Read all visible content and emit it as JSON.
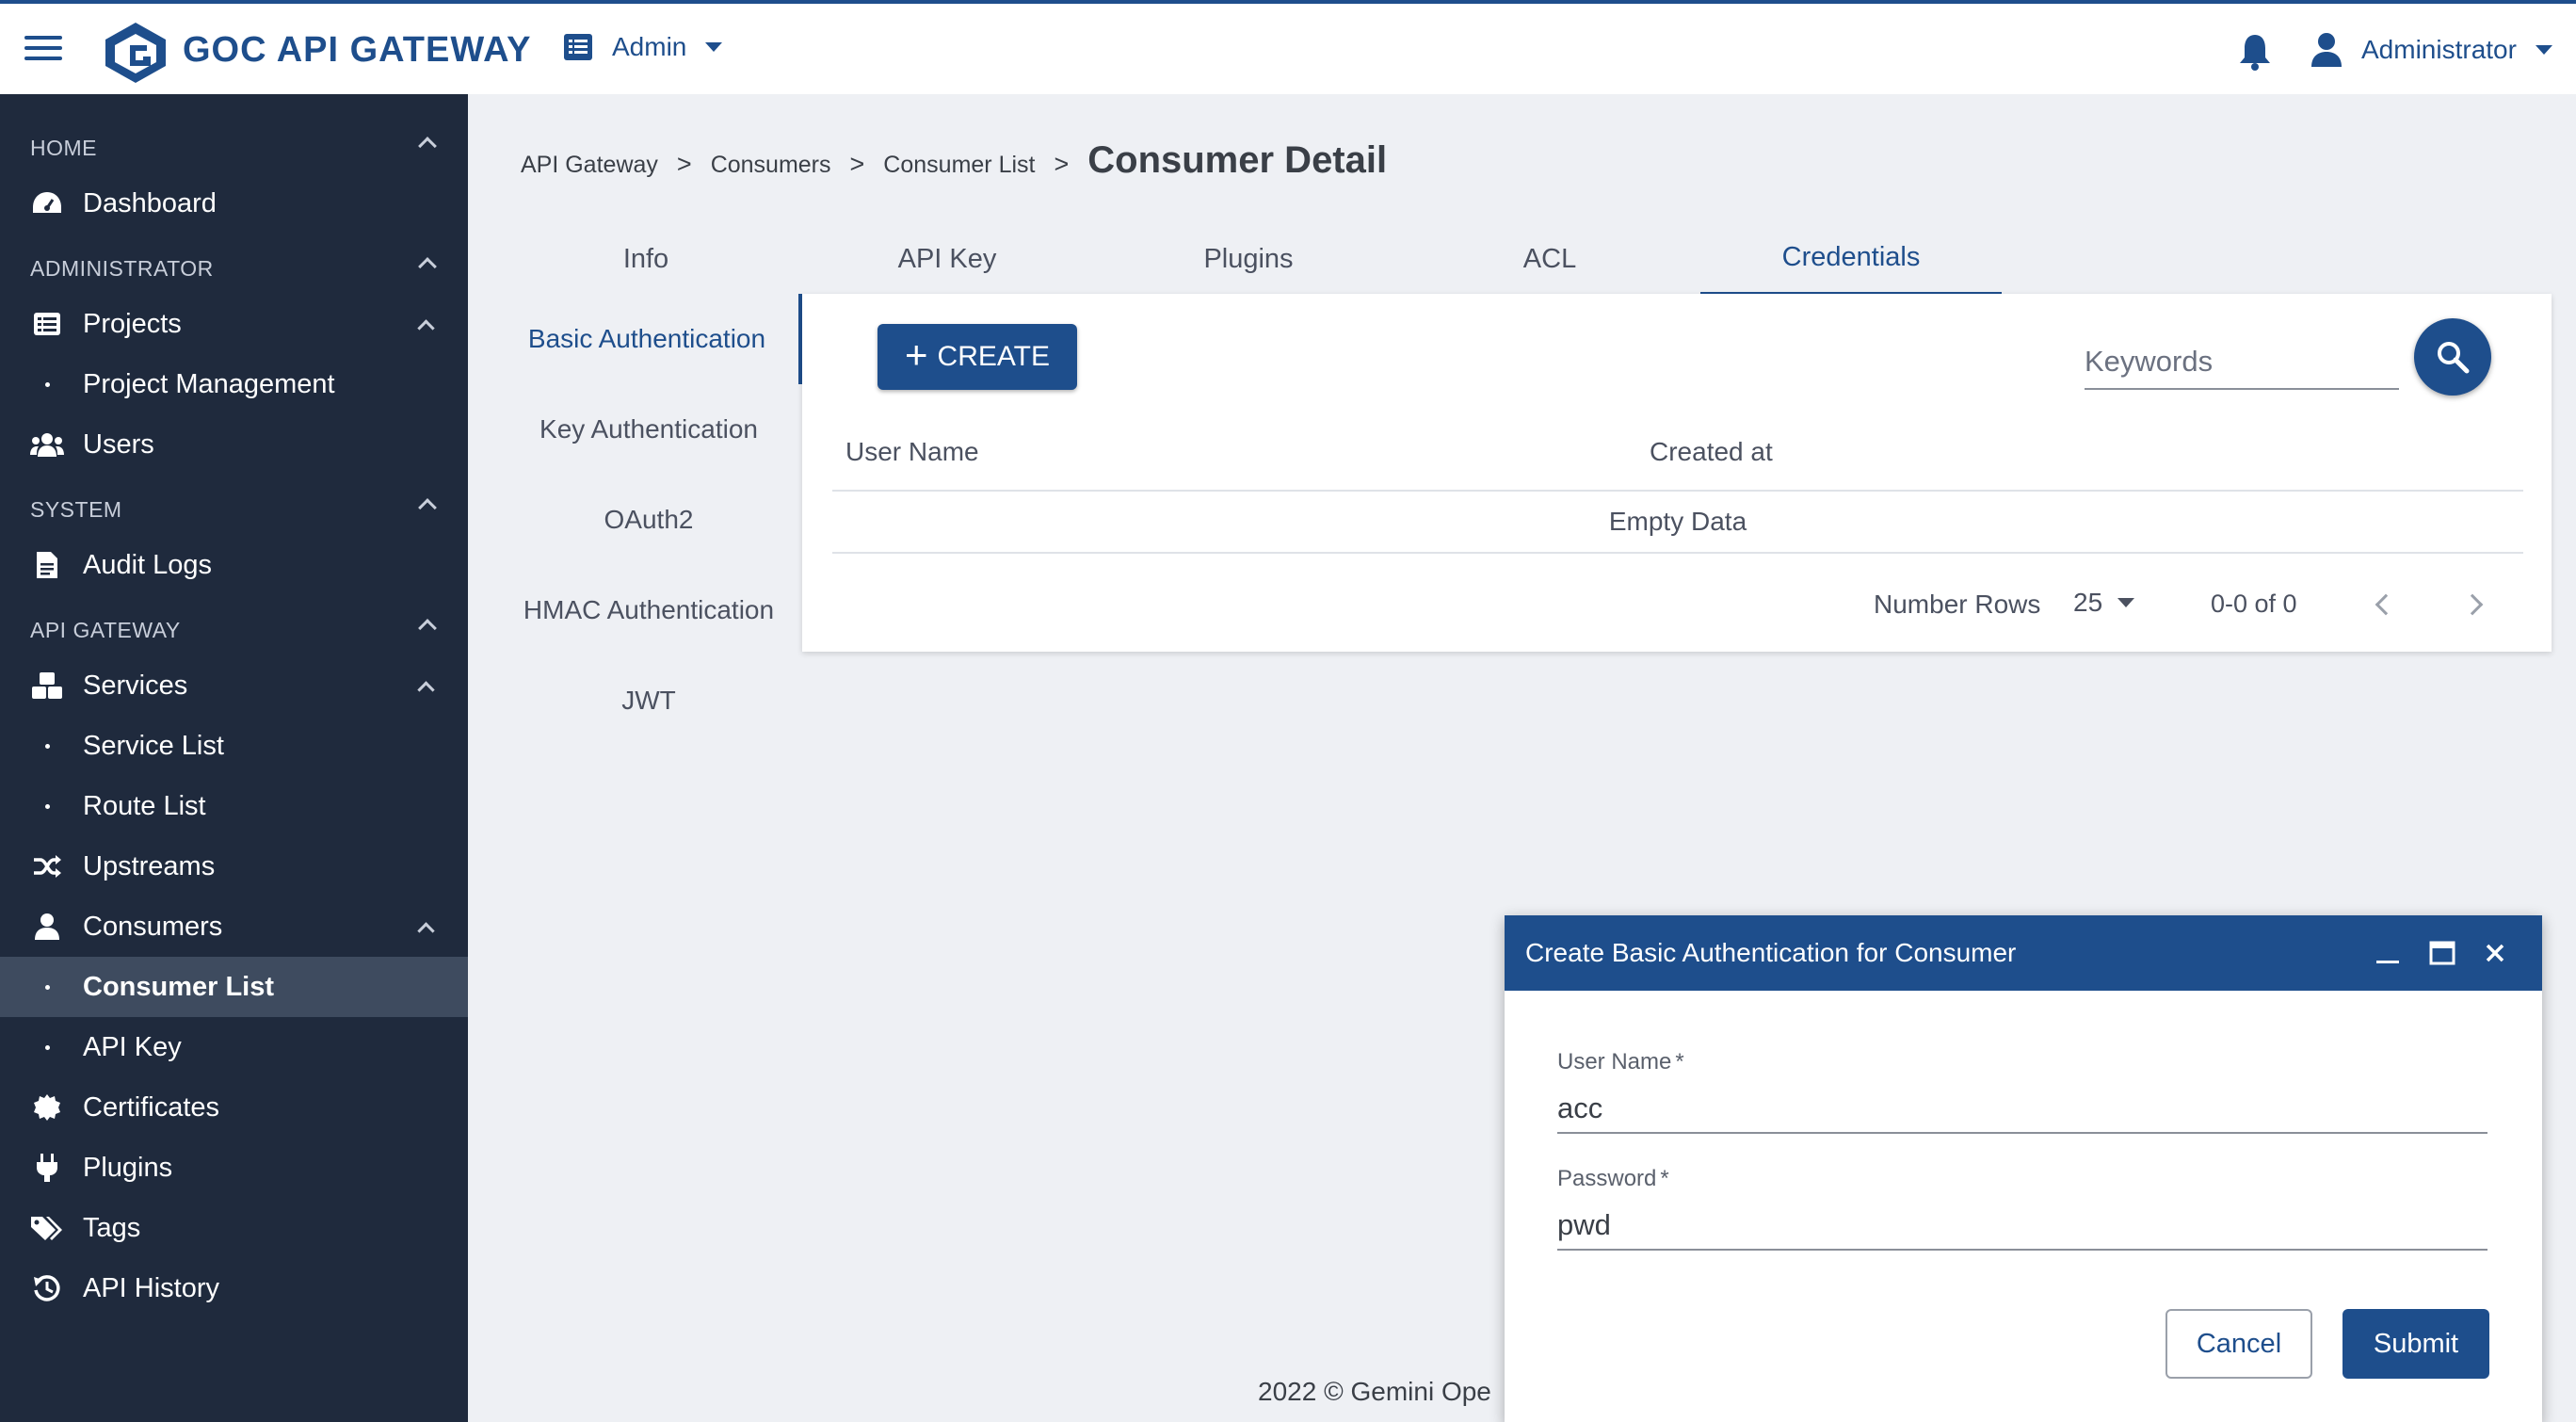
{
  "header": {
    "brand": "GOC API GATEWAY",
    "workspace_label": "Admin",
    "user_label": "Administrator"
  },
  "sidebar": {
    "sections": {
      "home": "HOME",
      "administrator": "ADMINISTRATOR",
      "system": "SYSTEM",
      "api_gateway": "API GATEWAY"
    },
    "items": {
      "dashboard": "Dashboard",
      "projects": "Projects",
      "project_management": "Project Management",
      "users": "Users",
      "audit_logs": "Audit Logs",
      "services": "Services",
      "service_list": "Service List",
      "route_list": "Route List",
      "upstreams": "Upstreams",
      "consumers": "Consumers",
      "consumer_list": "Consumer List",
      "api_key": "API Key",
      "certificates": "Certificates",
      "plugins": "Plugins",
      "tags": "Tags",
      "api_history": "API History"
    },
    "active_item": "Consumer List"
  },
  "breadcrumb": {
    "items": [
      "API Gateway",
      "Consumers",
      "Consumer List"
    ],
    "separator": ">",
    "current": "Consumer Detail"
  },
  "tabs": [
    "Info",
    "API Key",
    "Plugins",
    "ACL",
    "Credentials"
  ],
  "active_tab": "Credentials",
  "credential_types": [
    "Basic Authentication",
    "Key Authentication",
    "OAuth2",
    "HMAC Authentication",
    "JWT"
  ],
  "active_credential_type": "Basic Authentication",
  "panel": {
    "create_label": "CREATE",
    "search_placeholder": "Keywords",
    "columns": [
      "User Name",
      "Created at"
    ],
    "empty_text": "Empty Data",
    "rows_label": "Number Rows",
    "rows_per_page": "25",
    "range_text": "0-0 of 0"
  },
  "footer": {
    "text": "2022 © Gemini Ope"
  },
  "dialog": {
    "title": "Create Basic Authentication for Consumer",
    "username_label": "User Name",
    "username_value": "acc",
    "password_label": "Password",
    "password_value": "pwd",
    "required_mark": "*",
    "cancel_label": "Cancel",
    "submit_label": "Submit"
  },
  "colors": {
    "primary": "#1e4e8c",
    "sidebar_bg": "#1f2a3d",
    "sidebar_active": "#3e4b5f",
    "page_bg": "#eef0f4"
  }
}
